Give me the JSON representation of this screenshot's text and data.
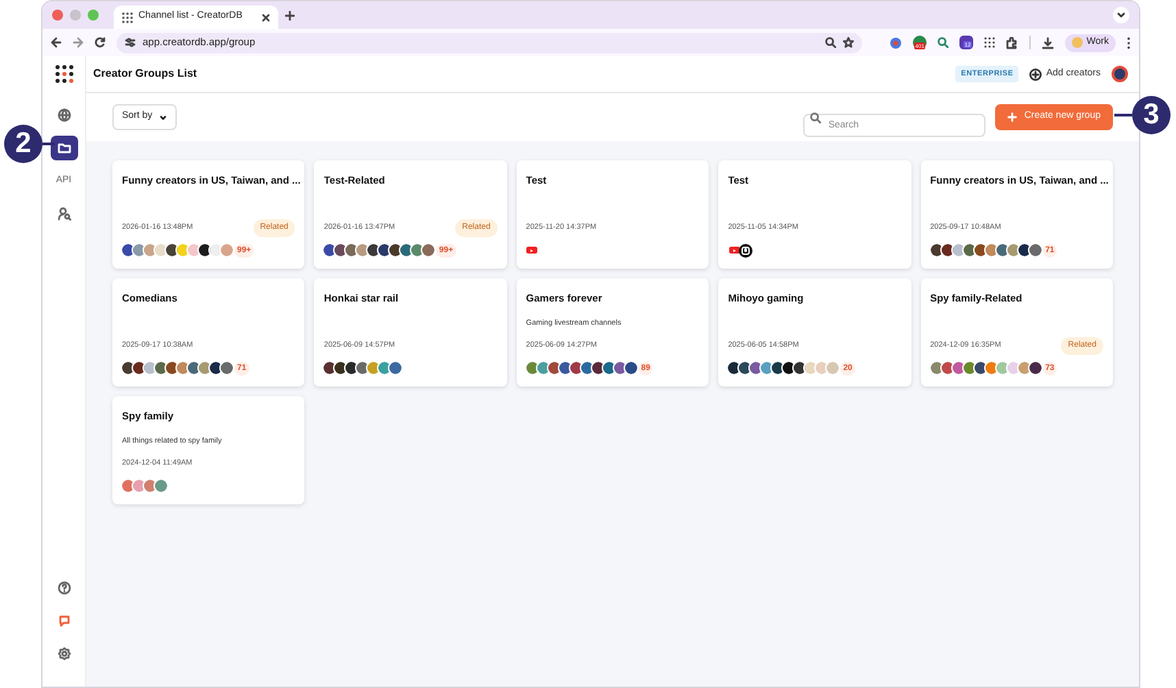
{
  "browser": {
    "tab_title": "Channel list - CreatorDB",
    "url": "app.creatordb.app/group",
    "profile": "Work",
    "extension_badge": "401",
    "extension_count": "12"
  },
  "sidebar": {
    "top": [
      {
        "kind": "globe",
        "selected": false
      },
      {
        "kind": "folder",
        "selected": true
      },
      {
        "kind": "api",
        "label": "API",
        "selected": false
      },
      {
        "kind": "person-search",
        "selected": false
      }
    ],
    "bottom": [
      {
        "kind": "help"
      },
      {
        "kind": "chat"
      },
      {
        "kind": "settings"
      }
    ]
  },
  "header": {
    "title": "Creator Groups List",
    "plan": "ENTERPRISE",
    "add_label": "Add creators"
  },
  "toolbar": {
    "sort_label": "Sort by",
    "search_placeholder": "Search",
    "create_label": "Create new group"
  },
  "groups": [
    {
      "title": "Funny creators in US, Taiwan, and ...",
      "date": "2026-01-16 13:48PM",
      "badge": "Related",
      "more": "99+",
      "channels": [
        {
          "kind": "avatar",
          "color": "#3b4aa8"
        },
        {
          "kind": "avatar",
          "color": "#8a9aa8"
        },
        {
          "kind": "avatar",
          "color": "#c9a58a"
        },
        {
          "kind": "avatar",
          "color": "#e8dcc8"
        },
        {
          "kind": "avatar",
          "color": "#4a4438"
        },
        {
          "kind": "avatar",
          "color": "#f2d21a"
        },
        {
          "kind": "avatar",
          "color": "#f4c6cc"
        },
        {
          "kind": "avatar",
          "color": "#1c1c1c"
        },
        {
          "kind": "avatar",
          "color": "#eeeeee"
        },
        {
          "kind": "avatar",
          "color": "#d9a58c"
        }
      ]
    },
    {
      "title": "Test-Related",
      "date": "2026-01-16 13:47PM",
      "badge": "Related",
      "more": "99+",
      "channels": [
        {
          "kind": "avatar",
          "color": "#3b4aa8"
        },
        {
          "kind": "avatar",
          "color": "#6a4a5a"
        },
        {
          "kind": "avatar",
          "color": "#7a6a5a"
        },
        {
          "kind": "avatar",
          "color": "#b89a80"
        },
        {
          "kind": "avatar",
          "color": "#3a3a3a"
        },
        {
          "kind": "avatar",
          "color": "#2a3a6a"
        },
        {
          "kind": "avatar",
          "color": "#4a3a2a"
        },
        {
          "kind": "avatar",
          "color": "#2a6a7a"
        },
        {
          "kind": "avatar",
          "color": "#5a8a6a"
        },
        {
          "kind": "avatar",
          "color": "#8a6a5a"
        }
      ]
    },
    {
      "title": "Test",
      "date": "2025-11-20 14:37PM",
      "channels": [
        {
          "kind": "youtube"
        }
      ]
    },
    {
      "title": "Test",
      "date": "2025-11-05 14:34PM",
      "channels": [
        {
          "kind": "youtube"
        },
        {
          "kind": "instagram"
        }
      ]
    },
    {
      "title": "Funny creators in US, Taiwan, and ...",
      "date": "2025-09-17 10:48AM",
      "more": "71",
      "channels": [
        {
          "kind": "avatar",
          "color": "#4a3a30"
        },
        {
          "kind": "avatar",
          "color": "#6a2a20"
        },
        {
          "kind": "avatar",
          "color": "#b8c0cc"
        },
        {
          "kind": "avatar",
          "color": "#5a6a4a"
        },
        {
          "kind": "avatar",
          "color": "#8a4a20"
        },
        {
          "kind": "avatar",
          "color": "#c08a5a"
        },
        {
          "kind": "avatar",
          "color": "#4a6a7a"
        },
        {
          "kind": "avatar",
          "color": "#a89a70"
        },
        {
          "kind": "avatar",
          "color": "#1a2a4a"
        },
        {
          "kind": "avatar",
          "color": "#6a6a6a"
        }
      ]
    },
    {
      "title": "Comedians",
      "date": "2025-09-17 10:38AM",
      "more": "71",
      "channels": [
        {
          "kind": "avatar",
          "color": "#4a3a30"
        },
        {
          "kind": "avatar",
          "color": "#6a2a20"
        },
        {
          "kind": "avatar",
          "color": "#b8c0cc"
        },
        {
          "kind": "avatar",
          "color": "#5a6a4a"
        },
        {
          "kind": "avatar",
          "color": "#8a4a20"
        },
        {
          "kind": "avatar",
          "color": "#c08a5a"
        },
        {
          "kind": "avatar",
          "color": "#4a6a7a"
        },
        {
          "kind": "avatar",
          "color": "#a89a70"
        },
        {
          "kind": "avatar",
          "color": "#1a2a4a"
        },
        {
          "kind": "avatar",
          "color": "#6a6a6a"
        }
      ]
    },
    {
      "title": "Honkai star rail",
      "date": "2025-06-09 14:57PM",
      "channels": [
        {
          "kind": "avatar",
          "color": "#5a3030"
        },
        {
          "kind": "avatar",
          "color": "#3a3020"
        },
        {
          "kind": "avatar",
          "color": "#2a2a2a"
        },
        {
          "kind": "avatar",
          "color": "#6a6a6a"
        },
        {
          "kind": "avatar",
          "color": "#c8a020"
        },
        {
          "kind": "avatar",
          "color": "#3aa0a0"
        },
        {
          "kind": "avatar",
          "color": "#3a6aa0"
        }
      ]
    },
    {
      "title": "Gamers forever",
      "description": "Gaming livestream channels",
      "date": "2025-06-09 14:27PM",
      "more": "89",
      "channels": [
        {
          "kind": "avatar",
          "color": "#6a8a3a"
        },
        {
          "kind": "avatar",
          "color": "#4aa0a0"
        },
        {
          "kind": "avatar",
          "color": "#a04a3a"
        },
        {
          "kind": "avatar",
          "color": "#3a5aa0"
        },
        {
          "kind": "avatar",
          "color": "#a03a4a"
        },
        {
          "kind": "avatar",
          "color": "#2a6aa0"
        },
        {
          "kind": "avatar",
          "color": "#5a2a3a"
        },
        {
          "kind": "avatar",
          "color": "#1a6a8a"
        },
        {
          "kind": "avatar",
          "color": "#7a5aa0"
        },
        {
          "kind": "avatar",
          "color": "#2a4a8a"
        }
      ]
    },
    {
      "title": "Mihoyo gaming",
      "date": "2025-06-05 14:58PM",
      "more": "20",
      "channels": [
        {
          "kind": "avatar",
          "color": "#1a2a3a"
        },
        {
          "kind": "avatar",
          "color": "#2a4a5a"
        },
        {
          "kind": "avatar",
          "color": "#7a5aa0"
        },
        {
          "kind": "avatar",
          "color": "#5aa0c0"
        },
        {
          "kind": "avatar",
          "color": "#1a3a4a"
        },
        {
          "kind": "avatar",
          "color": "#111111"
        },
        {
          "kind": "avatar",
          "color": "#333333"
        },
        {
          "kind": "avatar",
          "color": "#e8d8c0"
        },
        {
          "kind": "avatar",
          "color": "#e8d0c0"
        },
        {
          "kind": "avatar",
          "color": "#d8c8b0"
        }
      ]
    },
    {
      "title": "Spy family-Related",
      "date": "2024-12-09 16:35PM",
      "badge": "Related",
      "more": "73",
      "channels": [
        {
          "kind": "avatar",
          "color": "#8a8a6a"
        },
        {
          "kind": "avatar",
          "color": "#c04a4a"
        },
        {
          "kind": "avatar",
          "color": "#c05aa0"
        },
        {
          "kind": "avatar",
          "color": "#6a8a2a"
        },
        {
          "kind": "avatar",
          "color": "#3a4a6a"
        },
        {
          "kind": "avatar",
          "color": "#f07a10"
        },
        {
          "kind": "avatar",
          "color": "#a0c8a0"
        },
        {
          "kind": "avatar",
          "color": "#e8d0e8"
        },
        {
          "kind": "avatar",
          "color": "#c8a070"
        },
        {
          "kind": "avatar",
          "color": "#4a2a4a"
        }
      ]
    },
    {
      "title": "Spy family",
      "description": "All things related to spy family",
      "date": "2024-12-04 11:49AM",
      "channels": [
        {
          "kind": "avatar",
          "color": "#e07060"
        },
        {
          "kind": "avatar",
          "color": "#e8a0b0"
        },
        {
          "kind": "avatar",
          "color": "#d08070"
        },
        {
          "kind": "avatar",
          "color": "#6a9a8a"
        }
      ]
    }
  ],
  "callouts": [
    {
      "label": "2"
    },
    {
      "label": "3"
    }
  ]
}
